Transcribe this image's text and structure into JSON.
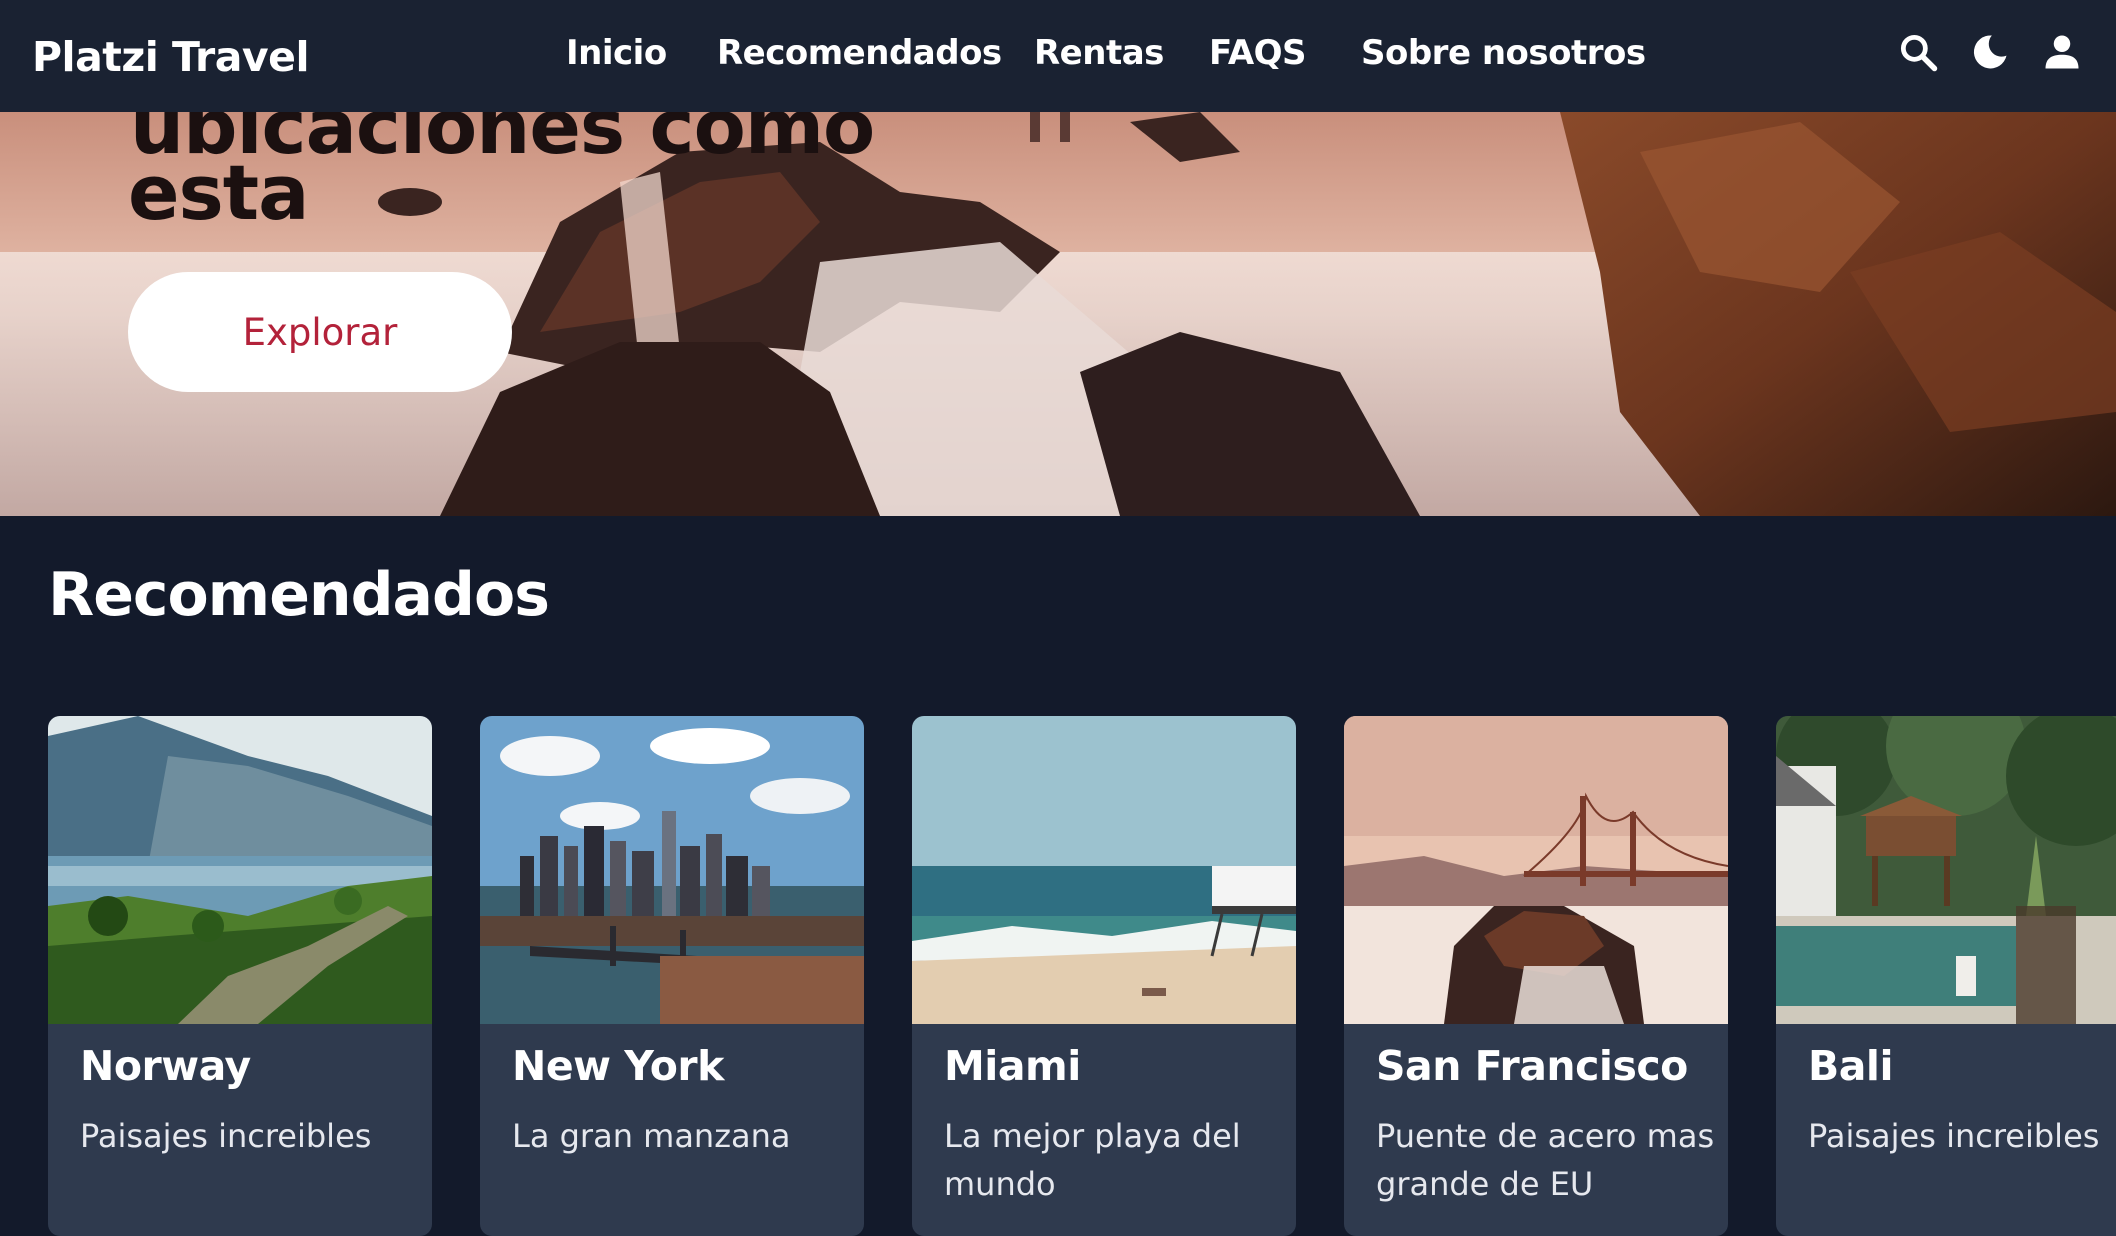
{
  "navbar": {
    "brand": "Platzi Travel",
    "links": [
      "Inicio",
      "Recomendados",
      "Rentas",
      "FAQS",
      "Sobre nosotros"
    ],
    "icons": [
      "search-icon",
      "moon-icon",
      "user-icon"
    ]
  },
  "hero": {
    "title_line1": "ubicaciones como",
    "title_line2": "esta",
    "button_label": "Explorar"
  },
  "recommended": {
    "title": "Recomendados",
    "cards": [
      {
        "title": "Norway",
        "description": "Paisajes increibles"
      },
      {
        "title": "New York",
        "description": "La gran manzana"
      },
      {
        "title": "Miami",
        "description": "La mejor playa del mundo"
      },
      {
        "title": "San Francisco",
        "description": "Puente de acero mas grande de EU"
      },
      {
        "title": "Bali",
        "description": "Paisajes increibles"
      }
    ]
  },
  "colors": {
    "navbar_bg": "#1a2232",
    "page_bg": "#131a2b",
    "card_bg": "#2f3a4e",
    "button_text": "#b3223a"
  }
}
